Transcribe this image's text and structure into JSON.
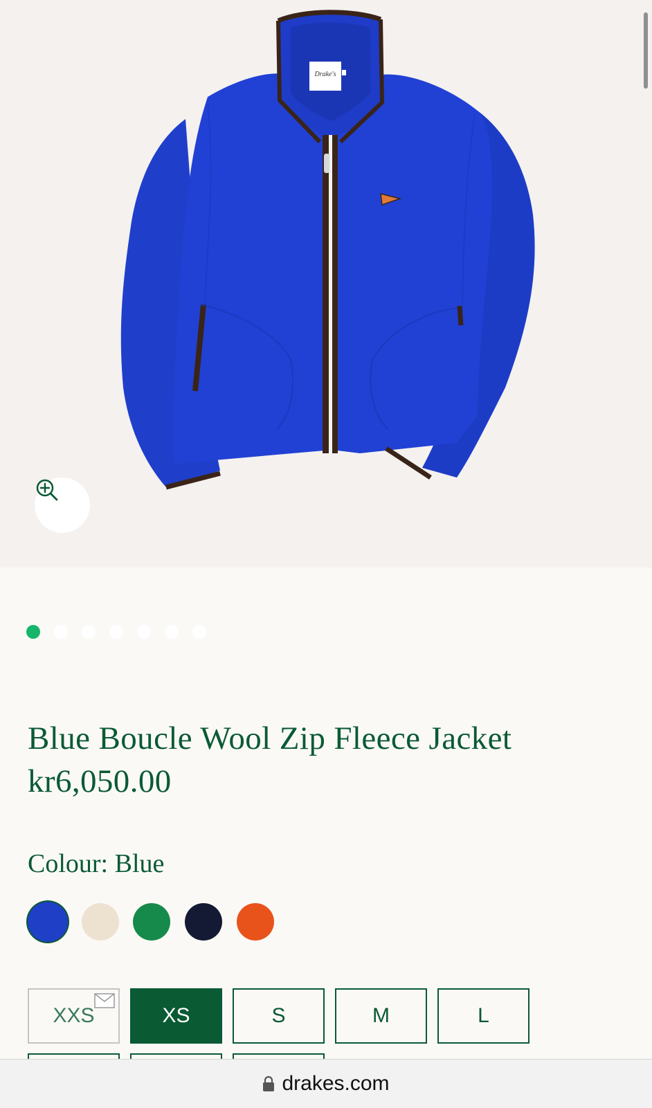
{
  "product": {
    "title": "Blue Boucle Wool Zip Fleece Jacket",
    "price": "kr6,050.00",
    "colour_label": "Colour: Blue",
    "label_text": "Drake's"
  },
  "gallery": {
    "image_count": 7,
    "active_index": 0,
    "zoom_icon": "zoom-in-icon"
  },
  "swatches": [
    {
      "name": "Blue",
      "color": "#1f3fc6",
      "selected": true
    },
    {
      "name": "Cream",
      "color": "#ece2cf",
      "selected": false
    },
    {
      "name": "Green",
      "color": "#168a4a",
      "selected": false
    },
    {
      "name": "Navy",
      "color": "#141a33",
      "selected": false
    },
    {
      "name": "Orange",
      "color": "#e8531c",
      "selected": false
    }
  ],
  "sizes": [
    {
      "label": "XXS",
      "state": "out-of-stock"
    },
    {
      "label": "XS",
      "state": "selected"
    },
    {
      "label": "S",
      "state": "available"
    },
    {
      "label": "M",
      "state": "available"
    },
    {
      "label": "L",
      "state": "available"
    }
  ],
  "browser": {
    "url": "drakes.com",
    "lock_icon": "lock-icon"
  },
  "colors": {
    "brand_green": "#0a5a34",
    "dot_active": "#16b66a",
    "jacket_blue": "#1e3fd0",
    "trim_brown": "#3a2418"
  }
}
